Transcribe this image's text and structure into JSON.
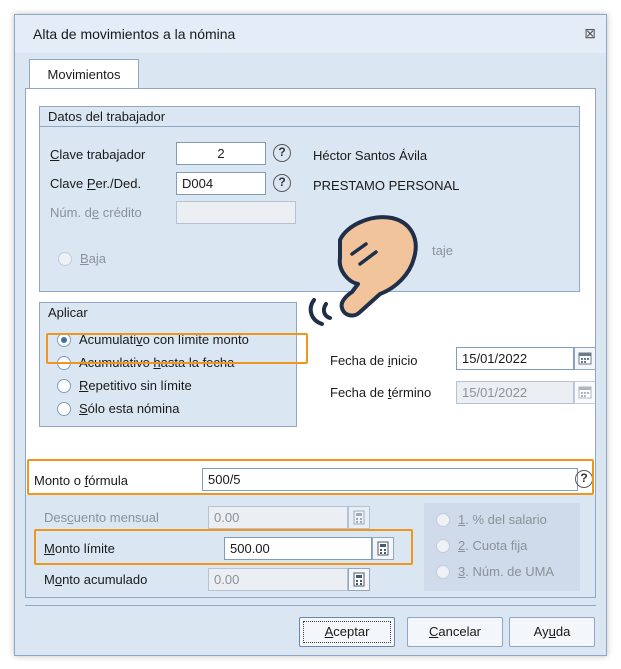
{
  "window": {
    "title": "Alta de movimientos a la nómina",
    "close_glyph": "⊠"
  },
  "tab": {
    "label": "Movimientos"
  },
  "worker": {
    "group_title": "Datos del trabajador",
    "clave_label_pre": "C",
    "clave_label_rest": "lave trabajador",
    "clave_value": "2",
    "worker_name": "Héctor Santos Ávila",
    "perded_label_pre": "Clave ",
    "perded_label_u": "P",
    "perded_label_rest": "er./Ded.",
    "perded_value": "D004",
    "perded_name": "PRESTAMO PERSONAL",
    "credito_label_pre": "Núm. d",
    "credito_label_u": "e",
    "credito_label_rest": " crédito",
    "credito_value": "",
    "baja_label_u": "B",
    "baja_label_rest": "aja",
    "porcentaje_partial": "taje"
  },
  "aplicar": {
    "group_title": "Aplicar",
    "options": [
      {
        "pre": "Acumulati",
        "u": "v",
        "rest": "o con límite monto",
        "checked": true
      },
      {
        "pre": "Acumulativo ",
        "u": "h",
        "rest": "asta la fecha",
        "checked": false
      },
      {
        "pre": "",
        "u": "R",
        "rest": "epetitivo sin límite",
        "checked": false
      },
      {
        "pre": "",
        "u": "S",
        "rest": "ólo esta nómina",
        "checked": false
      }
    ]
  },
  "fechas": {
    "inicio_pre": "Fecha de ",
    "inicio_u": "i",
    "inicio_rest": "nicio",
    "inicio_value": "15/01/2022",
    "termino_pre": "Fecha de ",
    "termino_u": "t",
    "termino_rest": "érmino",
    "termino_value": "15/01/2022"
  },
  "monto": {
    "formula_pre": "Monto o ",
    "formula_u": "f",
    "formula_rest": "órmula",
    "formula_value": "500/5",
    "descuento_pre": "Des",
    "descuento_u": "c",
    "descuento_rest": "uento mensual",
    "descuento_value": "0.00",
    "limite_u": "M",
    "limite_rest": "onto límite",
    "limite_value": "500.00",
    "acumulado_pre": "M",
    "acumulado_u": "o",
    "acumulado_rest": "nto acumulado",
    "acumulado_value": "0.00"
  },
  "calc_options": [
    {
      "u": "1",
      "rest": ". % del salario"
    },
    {
      "u": "2",
      "rest": ". Cuota fija"
    },
    {
      "u": "3",
      "rest": ". Núm. de UMA"
    }
  ],
  "buttons": {
    "aceptar_u": "A",
    "aceptar_rest": "ceptar",
    "cancelar_u": "C",
    "cancelar_rest": "ancelar",
    "ayuda_pre": "Ay",
    "ayuda_u": "u",
    "ayuda_rest": "da"
  },
  "colors": {
    "highlight": "#f0961f",
    "pointer_fill": "#f2c49b",
    "pointer_stroke": "#1f2f4a"
  }
}
